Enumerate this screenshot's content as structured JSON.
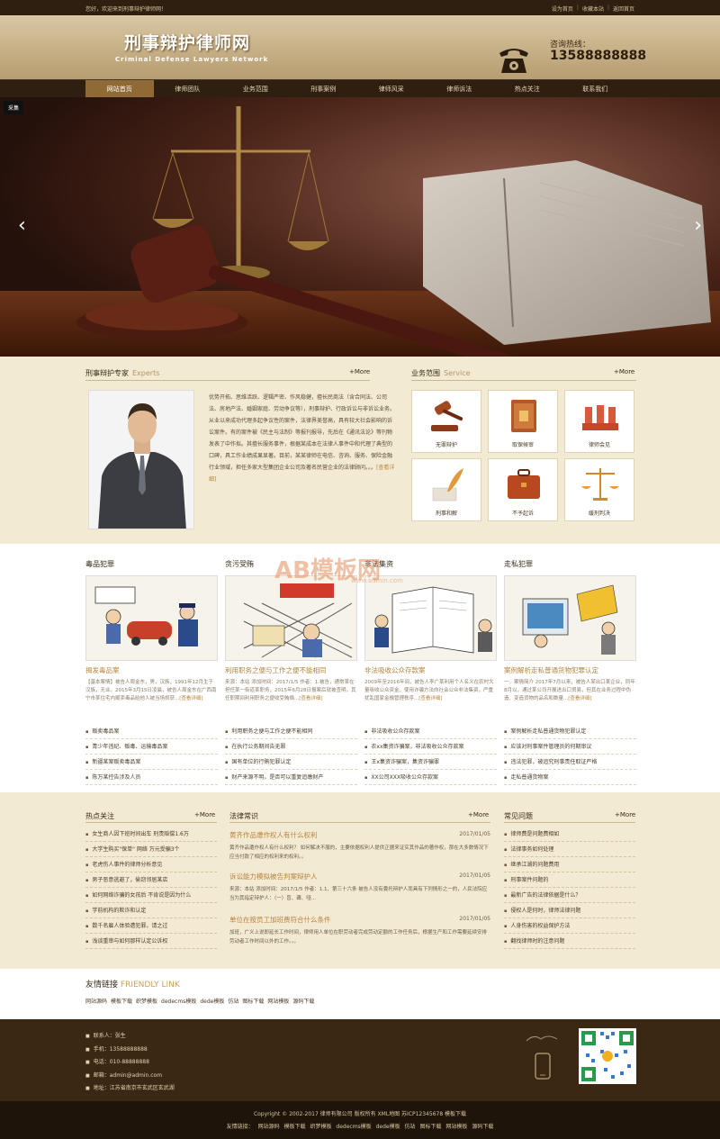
{
  "topbar": {
    "welcome": "您好，欢迎来到刑事辩护律师网！",
    "links": [
      "设为首页",
      "收藏本站",
      "返回首页"
    ]
  },
  "header": {
    "logo_cn": "刑事辩护律师网",
    "logo_en": "Criminal Defense Lawyers Network",
    "hotline_label": "咨询热线：",
    "hotline_number": "13588888888"
  },
  "nav": {
    "items": [
      "网站首页",
      "律师团队",
      "业务范围",
      "刑事案例",
      "律师风采",
      "律师诉法",
      "热点关注",
      "联系我们"
    ]
  },
  "banner": {
    "tag": "采集",
    "prev": "‹",
    "next": "›"
  },
  "expert": {
    "title": "刑事辩护专家",
    "title_en": "Experts",
    "more": "+More",
    "about": "优势开拓、思维活跃、逻辑严密、作风稳健，擅长民商法（含合同法、公司法、房地产法、婚姻家庭、劳动争议等），刑事辩护、行政诉讼与非诉讼业务。从业以来成功代理多起争议性的案件，法律界美誉高，具有较大社会影响的诉讼案件。有的案件被《民主与法制》等报刊报导，先后在《通讯法论》等刊物发表了中作拟。其擅长服务事件，根据某成本在法律人事件中和代理了典型的口碑，具工作业绩成果显著。目前，某某律师在电信、咨询、服务、保险金融行业领域，担任多家大型集团企业公司及著名民营企业的法律顾问。。。",
    "about_more": "[查看详细]"
  },
  "service": {
    "title": "业务范围",
    "title_en": "Service",
    "more": "+More",
    "items": [
      "无罪辩护",
      "取保候审",
      "律师会见",
      "刑事和解",
      "不予起诉",
      "缓刑判决"
    ]
  },
  "columns": [
    {
      "title": "毒品犯罪",
      "headline": "揭发毒品案",
      "desc": "【基本案情】被告人周金东，男，汉族，1991年12月生于汉族，无业。2015年3月15日凌晨，被告人周金东在广西南宁市某住宅内贩卖毒品给他人被当场抓获...",
      "desc_more": "[查看详细]",
      "items": [
        "贩卖毒品案",
        "青少年违纪、贩毒、运输毒品案",
        "新疆某案贩卖毒品案",
        "陈万某控告涉及人员"
      ]
    },
    {
      "title": "贪污受贿",
      "headline": "利用职务之便与工作之便不能相同",
      "desc": "来源：本站 添加时间：2017/1/5 作者：1.被告，通常某在担任某一街道某职务，2015年6月28日报案后就被查明，其任职期间利用职务之便收受贿赂...",
      "desc_more": "[查看详细]",
      "items": [
        "利用职务之便与工作之便不能相同",
        "在执行公务期间告无罪",
        "国有单位的行贿犯罪认定",
        "财产来源不明，是否可以重复追缴财产"
      ]
    },
    {
      "title": "非法集资",
      "headline": "非法吸收公众存款案",
      "desc": "2009年至2016年间，被告人李广某利用个人名义在农村大量吸收公众资金，使用诈骗方法向社会公众非法集资，严重扰乱国家金融管理秩序...",
      "desc_more": "[查看详细]",
      "items": [
        "非法吸收公众存款案",
        "农xx集资诈骗案，非法吸收公众存款案",
        "王x集资诈骗案，集资诈骗罪",
        "XX公司XXX吸收公众存款案"
      ]
    },
    {
      "title": "走私犯罪",
      "headline": "案例解析走私普通货物犯罪认定",
      "desc": "一、案情简介 2017年7月以来，被告人某出口某企业，同年8月以，通过某公司开展进出口贸易，但其在业务过程中伪造、变造货物的品名和数量...",
      "desc_more": "[查看详细]",
      "items": [
        "案例解析走私普通货物犯罪认定",
        "应该对刑事案件管理员的何期审议",
        "违法犯罪，被追究刑事责任取证严格",
        "走私普通货物案"
      ]
    }
  ],
  "hot": {
    "title": "热点关注",
    "more": "+More",
    "items": [
      "女生商人因下班时间出车 刑责赔偿1.6万",
      "大学生购买\"保单\" 网络 万元受骗3个",
      "老虎伤人事件的律师分析意见",
      "男子恶意逃避了，偷窃邻居某店",
      "如何网络诈骗的女孩后 不肯说是因为什么",
      "学前机构的欺诈和认定",
      "数千名雇人体验遭犯罪，请之过",
      "浅谈重审与如何那样认定公诉权"
    ]
  },
  "law": {
    "title": "法律常识",
    "more": "+More",
    "entries": [
      {
        "title": "黄齐作品遭作权人有什么权利",
        "date": "2017/01/05",
        "text": "黄齐作品遭作权人有什么权利？ 如何解决不服的，主要依据权利人提供正据来证实其作品的著作权，那在大多数情况下应当付款了相应的权利来的权利。。"
      },
      {
        "title": "诉讼能力模拟被告判案辩护人",
        "date": "2017/01/05",
        "text": "来源：本站 添加时间：2017/1/5 作者：1.1、第三十六条 被告人没有委托辩护人而具有下列情形之一的，人民法院应当为其指定辩护人：（一）盲、聋、哑..."
      },
      {
        "title": "单位在按员工加班费符合什么条件",
        "date": "2017/01/05",
        "text": "加班，广义上说即延长工作时间，律师用人单位在职劳动者完成劳动定额的工作任务后，根据生产和工作需要延续安排劳动者工作时间以外的工作。。。"
      }
    ]
  },
  "faq": {
    "title": "常见问题",
    "more": "+More",
    "items": [
      "律师费是问题费相如",
      "法律事务如何处理",
      "继承江湖的问题费用",
      "刑事案件问题的",
      "最新广告的法律依据是什么？",
      "侵权人是何时，律师法律问题",
      "人身伤害的权益保护方法",
      "翻找律师时的注意问题"
    ]
  },
  "friend": {
    "title": "友情链接",
    "title_en": "FRIENDLY LINK",
    "links": [
      "网站源码",
      "模板下载",
      "织梦模板",
      "dedecms模板",
      "dede模板",
      "仿站",
      "图标下载",
      "网站模板",
      "源码下载"
    ]
  },
  "footer": {
    "contact": "联系人：张生",
    "phone": "手机：13588888888",
    "tel": "电话：010-88888888",
    "email": "邮箱：admin@admin.com",
    "address": "地址：江苏省南京市玄武区玄武湖",
    "copyright": "Copyright © 2002-2017 律师有限公司 版权所有 XML地图 苏ICP12345678 模板下载",
    "links_label": "友情链接：",
    "links": [
      "网站源码",
      "模板下载",
      "织梦模板",
      "dedecms模板",
      "dede模板",
      "仿站",
      "图标下载",
      "网站模板",
      "源码下载"
    ]
  },
  "watermark": {
    "main": "AB模板网",
    "sub": "www.admin.com"
  },
  "colors": {
    "brown_dark": "#2e1f10",
    "accent": "#b8833c",
    "cream": "#f3ead3",
    "nav_active": "#8f6a35"
  }
}
